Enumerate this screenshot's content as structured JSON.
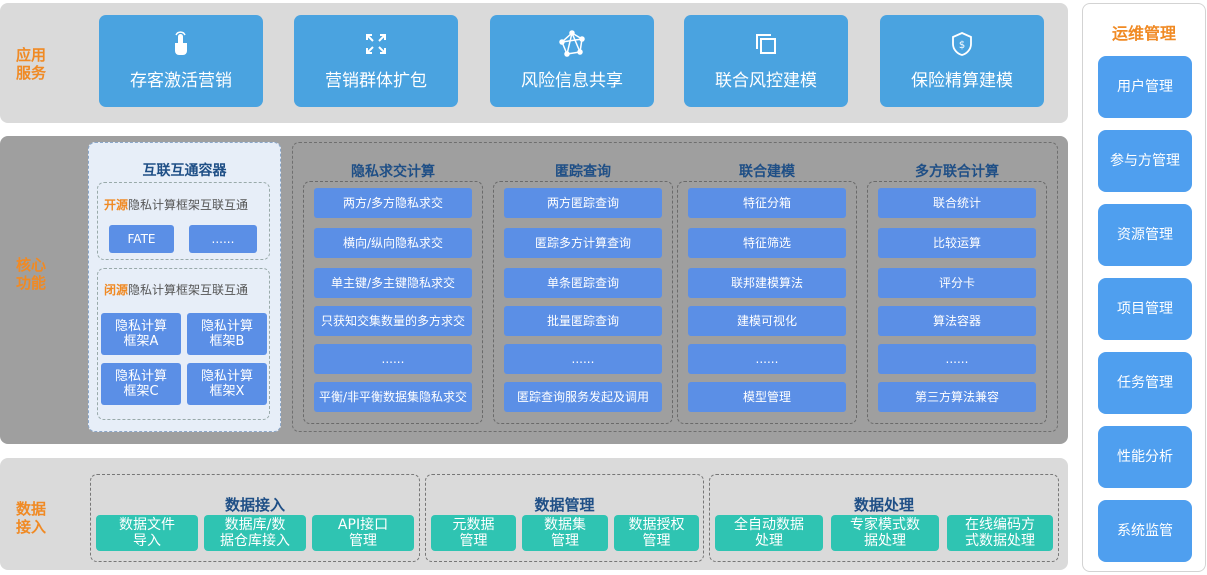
{
  "sections": {
    "app_label": "应用\n服务",
    "core_label": "核心\n功能",
    "data_label": "数据\n接入"
  },
  "apps": [
    {
      "label": "存客激活营销",
      "icon": "touch-icon"
    },
    {
      "label": "营销群体扩包",
      "icon": "expand-icon"
    },
    {
      "label": "风险信息共享",
      "icon": "network-icon"
    },
    {
      "label": "联合风控建模",
      "icon": "copy-icon"
    },
    {
      "label": "保险精算建模",
      "icon": "shield-dollar-icon"
    }
  ],
  "interop": {
    "title": "互联互通容器",
    "open": {
      "prefix": "开源",
      "rest": "隐私计算框架互联互通",
      "items": [
        "FATE",
        "......"
      ]
    },
    "closed": {
      "prefix": "闭源",
      "rest": "隐私计算框架互联互通",
      "items": [
        "隐私计算\n框架A",
        "隐私计算\n框架B",
        "隐私计算\n框架C",
        "隐私计算\n框架X"
      ]
    }
  },
  "columns": [
    {
      "title": "隐私求交计算",
      "items": [
        "两方/多方隐私求交",
        "横向/纵向隐私求交",
        "单主键/多主键隐私求交",
        "只获知交集数量的多方求交",
        "......",
        "平衡/非平衡数据集隐私求交"
      ]
    },
    {
      "title": "匿踪查询",
      "items": [
        "两方匿踪查询",
        "匿踪多方计算查询",
        "单条匿踪查询",
        "批量匿踪查询",
        "......",
        "匿踪查询服务发起及调用"
      ]
    },
    {
      "title": "联合建模",
      "items": [
        "特征分箱",
        "特征筛选",
        "联邦建模算法",
        "建模可视化",
        "......",
        "模型管理"
      ]
    },
    {
      "title": "多方联合计算",
      "items": [
        "联合统计",
        "比较运算",
        "评分卡",
        "算法容器",
        "......",
        "第三方算法兼容"
      ]
    }
  ],
  "data_groups": [
    {
      "title": "数据接入",
      "items": [
        "数据文件\n导入",
        "数据库/数\n据仓库接入",
        "API接口\n管理"
      ]
    },
    {
      "title": "数据管理",
      "items": [
        "元数据\n管理",
        "数据集\n管理",
        "数据授权\n管理"
      ]
    },
    {
      "title": "数据处理",
      "items": [
        "全自动数据\n处理",
        "专家模式数\n据处理",
        "在线编码方\n式数据处理"
      ]
    }
  ],
  "ops": {
    "title": "运维管理",
    "items": [
      "用户管理",
      "参与方管理",
      "资源管理",
      "项目管理",
      "任务管理",
      "性能分析",
      "系统监管"
    ]
  },
  "colors": {
    "accent": "#f08a24",
    "app_card": "#4aa3e0",
    "pill": "#5b8fe6",
    "green": "#2fc4b2",
    "side": "#4f9fef"
  }
}
